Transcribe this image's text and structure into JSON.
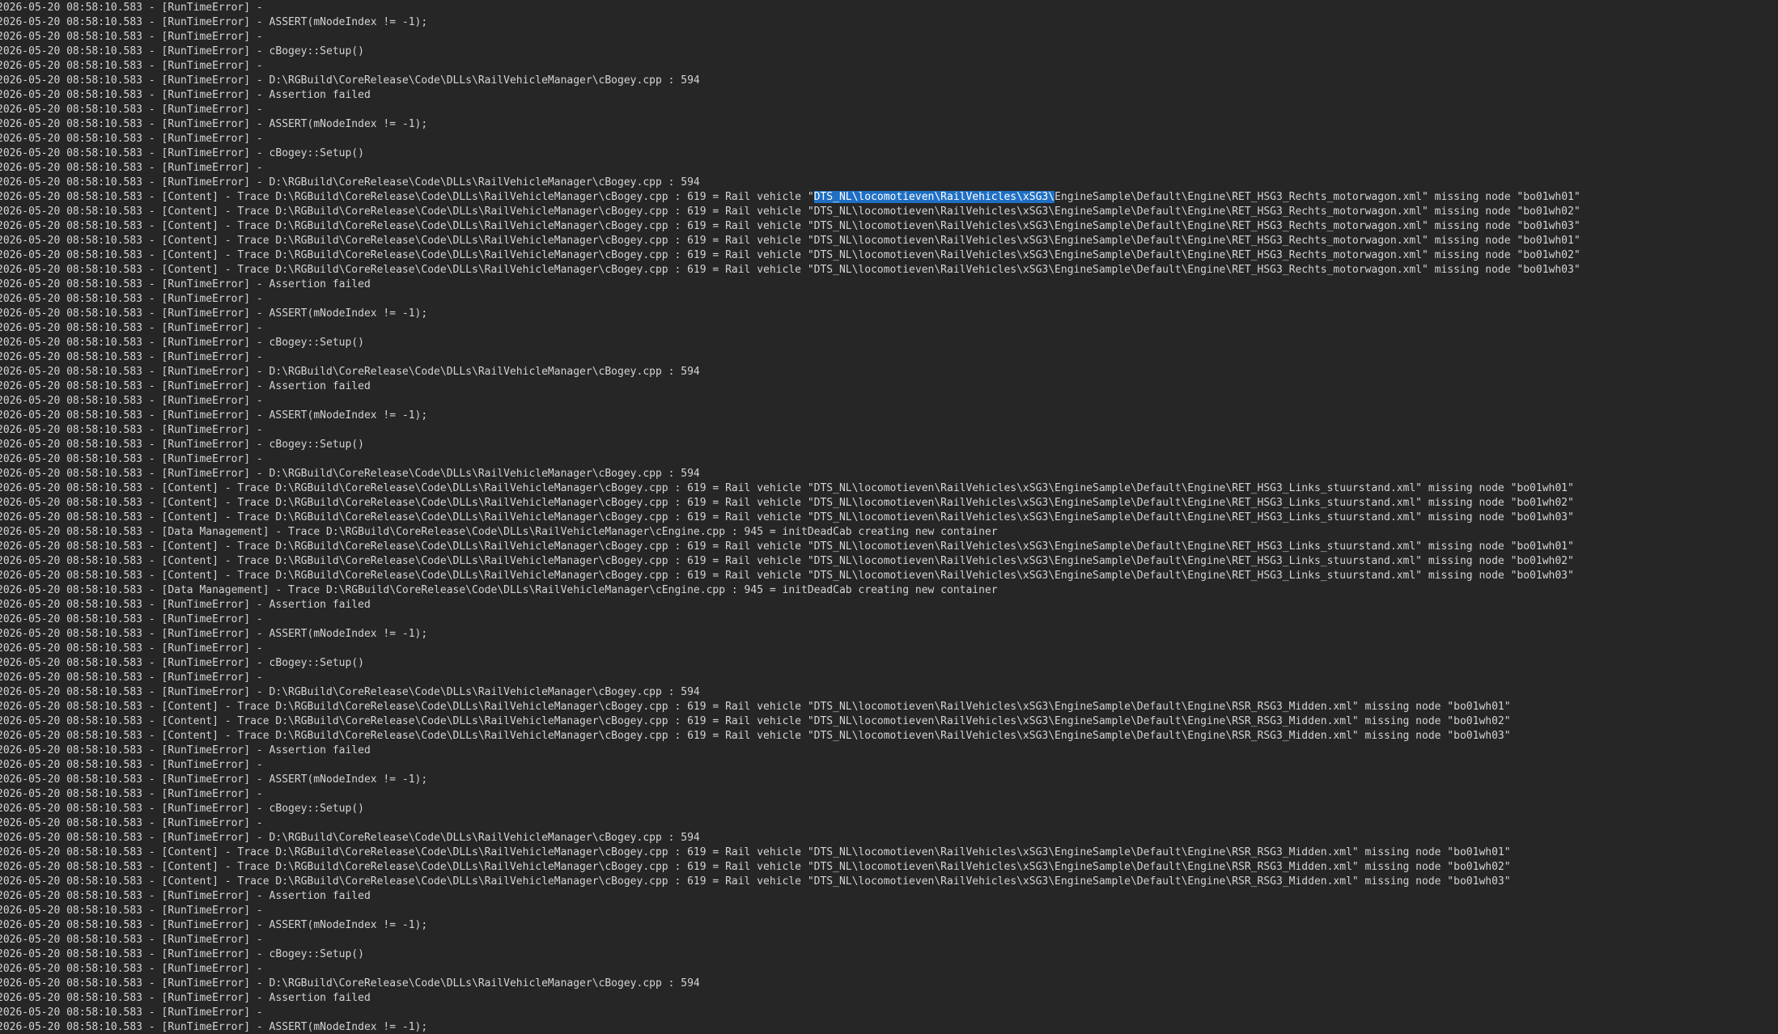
{
  "theme": {
    "background": "#262626",
    "text": "#d4d4d4",
    "selection_background": "#1f6fc5",
    "selection_text": "#ffffff"
  },
  "log": {
    "lines": [
      {
        "text": "2026-05-20 08:58:10.583 - [RunTimeError] -"
      },
      {
        "text": "2026-05-20 08:58:10.583 - [RunTimeError] - ASSERT(mNodeIndex != -1);"
      },
      {
        "text": "2026-05-20 08:58:10.583 - [RunTimeError] -"
      },
      {
        "text": "2026-05-20 08:58:10.583 - [RunTimeError] - cBogey::Setup()"
      },
      {
        "text": "2026-05-20 08:58:10.583 - [RunTimeError] -"
      },
      {
        "text": "2026-05-20 08:58:10.583 - [RunTimeError] - D:\\RGBuild\\CoreRelease\\Code\\DLLs\\RailVehicleManager\\cBogey.cpp : 594"
      },
      {
        "text": "2026-05-20 08:58:10.583 - [RunTimeError] - Assertion failed"
      },
      {
        "text": "2026-05-20 08:58:10.583 - [RunTimeError] -"
      },
      {
        "text": "2026-05-20 08:58:10.583 - [RunTimeError] - ASSERT(mNodeIndex != -1);"
      },
      {
        "text": "2026-05-20 08:58:10.583 - [RunTimeError] -"
      },
      {
        "text": "2026-05-20 08:58:10.583 - [RunTimeError] - cBogey::Setup()"
      },
      {
        "text": "2026-05-20 08:58:10.583 - [RunTimeError] -"
      },
      {
        "text": "2026-05-20 08:58:10.583 - [RunTimeError] - D:\\RGBuild\\CoreRelease\\Code\\DLLs\\RailVehicleManager\\cBogey.cpp : 594"
      },
      {
        "before": "2026-05-20 08:58:10.583 - [Content] - Trace D:\\RGBuild\\CoreRelease\\Code\\DLLs\\RailVehicleManager\\cBogey.cpp : 619 = Rail vehicle \"",
        "selected": "DTS_NL\\locomotieven\\RailVehicles\\xSG3\\",
        "after": "EngineSample\\Default\\Engine\\RET_HSG3_Rechts_motorwagon.xml\" missing node \"bo01wh01\""
      },
      {
        "text": "2026-05-20 08:58:10.583 - [Content] - Trace D:\\RGBuild\\CoreRelease\\Code\\DLLs\\RailVehicleManager\\cBogey.cpp : 619 = Rail vehicle \"DTS_NL\\locomotieven\\RailVehicles\\xSG3\\EngineSample\\Default\\Engine\\RET_HSG3_Rechts_motorwagon.xml\" missing node \"bo01wh02\""
      },
      {
        "text": "2026-05-20 08:58:10.583 - [Content] - Trace D:\\RGBuild\\CoreRelease\\Code\\DLLs\\RailVehicleManager\\cBogey.cpp : 619 = Rail vehicle \"DTS_NL\\locomotieven\\RailVehicles\\xSG3\\EngineSample\\Default\\Engine\\RET_HSG3_Rechts_motorwagon.xml\" missing node \"bo01wh03\""
      },
      {
        "text": "2026-05-20 08:58:10.583 - [Content] - Trace D:\\RGBuild\\CoreRelease\\Code\\DLLs\\RailVehicleManager\\cBogey.cpp : 619 = Rail vehicle \"DTS_NL\\locomotieven\\RailVehicles\\xSG3\\EngineSample\\Default\\Engine\\RET_HSG3_Rechts_motorwagon.xml\" missing node \"bo01wh01\""
      },
      {
        "text": "2026-05-20 08:58:10.583 - [Content] - Trace D:\\RGBuild\\CoreRelease\\Code\\DLLs\\RailVehicleManager\\cBogey.cpp : 619 = Rail vehicle \"DTS_NL\\locomotieven\\RailVehicles\\xSG3\\EngineSample\\Default\\Engine\\RET_HSG3_Rechts_motorwagon.xml\" missing node \"bo01wh02\""
      },
      {
        "text": "2026-05-20 08:58:10.583 - [Content] - Trace D:\\RGBuild\\CoreRelease\\Code\\DLLs\\RailVehicleManager\\cBogey.cpp : 619 = Rail vehicle \"DTS_NL\\locomotieven\\RailVehicles\\xSG3\\EngineSample\\Default\\Engine\\RET_HSG3_Rechts_motorwagon.xml\" missing node \"bo01wh03\""
      },
      {
        "text": "2026-05-20 08:58:10.583 - [RunTimeError] - Assertion failed"
      },
      {
        "text": "2026-05-20 08:58:10.583 - [RunTimeError] -"
      },
      {
        "text": "2026-05-20 08:58:10.583 - [RunTimeError] - ASSERT(mNodeIndex != -1);"
      },
      {
        "text": "2026-05-20 08:58:10.583 - [RunTimeError] -"
      },
      {
        "text": "2026-05-20 08:58:10.583 - [RunTimeError] - cBogey::Setup()"
      },
      {
        "text": "2026-05-20 08:58:10.583 - [RunTimeError] -"
      },
      {
        "text": "2026-05-20 08:58:10.583 - [RunTimeError] - D:\\RGBuild\\CoreRelease\\Code\\DLLs\\RailVehicleManager\\cBogey.cpp : 594"
      },
      {
        "text": "2026-05-20 08:58:10.583 - [RunTimeError] - Assertion failed"
      },
      {
        "text": "2026-05-20 08:58:10.583 - [RunTimeError] -"
      },
      {
        "text": "2026-05-20 08:58:10.583 - [RunTimeError] - ASSERT(mNodeIndex != -1);"
      },
      {
        "text": "2026-05-20 08:58:10.583 - [RunTimeError] -"
      },
      {
        "text": "2026-05-20 08:58:10.583 - [RunTimeError] - cBogey::Setup()"
      },
      {
        "text": "2026-05-20 08:58:10.583 - [RunTimeError] -"
      },
      {
        "text": "2026-05-20 08:58:10.583 - [RunTimeError] - D:\\RGBuild\\CoreRelease\\Code\\DLLs\\RailVehicleManager\\cBogey.cpp : 594"
      },
      {
        "text": "2026-05-20 08:58:10.583 - [Content] - Trace D:\\RGBuild\\CoreRelease\\Code\\DLLs\\RailVehicleManager\\cBogey.cpp : 619 = Rail vehicle \"DTS_NL\\locomotieven\\RailVehicles\\xSG3\\EngineSample\\Default\\Engine\\RET_HSG3_Links_stuurstand.xml\" missing node \"bo01wh01\""
      },
      {
        "text": "2026-05-20 08:58:10.583 - [Content] - Trace D:\\RGBuild\\CoreRelease\\Code\\DLLs\\RailVehicleManager\\cBogey.cpp : 619 = Rail vehicle \"DTS_NL\\locomotieven\\RailVehicles\\xSG3\\EngineSample\\Default\\Engine\\RET_HSG3_Links_stuurstand.xml\" missing node \"bo01wh02\""
      },
      {
        "text": "2026-05-20 08:58:10.583 - [Content] - Trace D:\\RGBuild\\CoreRelease\\Code\\DLLs\\RailVehicleManager\\cBogey.cpp : 619 = Rail vehicle \"DTS_NL\\locomotieven\\RailVehicles\\xSG3\\EngineSample\\Default\\Engine\\RET_HSG3_Links_stuurstand.xml\" missing node \"bo01wh03\""
      },
      {
        "text": "2026-05-20 08:58:10.583 - [Data Management] - Trace D:\\RGBuild\\CoreRelease\\Code\\DLLs\\RailVehicleManager\\cEngine.cpp : 945 = initDeadCab creating new container"
      },
      {
        "text": "2026-05-20 08:58:10.583 - [Content] - Trace D:\\RGBuild\\CoreRelease\\Code\\DLLs\\RailVehicleManager\\cBogey.cpp : 619 = Rail vehicle \"DTS_NL\\locomotieven\\RailVehicles\\xSG3\\EngineSample\\Default\\Engine\\RET_HSG3_Links_stuurstand.xml\" missing node \"bo01wh01\""
      },
      {
        "text": "2026-05-20 08:58:10.583 - [Content] - Trace D:\\RGBuild\\CoreRelease\\Code\\DLLs\\RailVehicleManager\\cBogey.cpp : 619 = Rail vehicle \"DTS_NL\\locomotieven\\RailVehicles\\xSG3\\EngineSample\\Default\\Engine\\RET_HSG3_Links_stuurstand.xml\" missing node \"bo01wh02\""
      },
      {
        "text": "2026-05-20 08:58:10.583 - [Content] - Trace D:\\RGBuild\\CoreRelease\\Code\\DLLs\\RailVehicleManager\\cBogey.cpp : 619 = Rail vehicle \"DTS_NL\\locomotieven\\RailVehicles\\xSG3\\EngineSample\\Default\\Engine\\RET_HSG3_Links_stuurstand.xml\" missing node \"bo01wh03\""
      },
      {
        "text": "2026-05-20 08:58:10.583 - [Data Management] - Trace D:\\RGBuild\\CoreRelease\\Code\\DLLs\\RailVehicleManager\\cEngine.cpp : 945 = initDeadCab creating new container"
      },
      {
        "text": "2026-05-20 08:58:10.583 - [RunTimeError] - Assertion failed"
      },
      {
        "text": "2026-05-20 08:58:10.583 - [RunTimeError] -"
      },
      {
        "text": "2026-05-20 08:58:10.583 - [RunTimeError] - ASSERT(mNodeIndex != -1);"
      },
      {
        "text": "2026-05-20 08:58:10.583 - [RunTimeError] -"
      },
      {
        "text": "2026-05-20 08:58:10.583 - [RunTimeError] - cBogey::Setup()"
      },
      {
        "text": "2026-05-20 08:58:10.583 - [RunTimeError] -"
      },
      {
        "text": "2026-05-20 08:58:10.583 - [RunTimeError] - D:\\RGBuild\\CoreRelease\\Code\\DLLs\\RailVehicleManager\\cBogey.cpp : 594"
      },
      {
        "text": "2026-05-20 08:58:10.583 - [Content] - Trace D:\\RGBuild\\CoreRelease\\Code\\DLLs\\RailVehicleManager\\cBogey.cpp : 619 = Rail vehicle \"DTS_NL\\locomotieven\\RailVehicles\\xSG3\\EngineSample\\Default\\Engine\\RSR_RSG3_Midden.xml\" missing node \"bo01wh01\""
      },
      {
        "text": "2026-05-20 08:58:10.583 - [Content] - Trace D:\\RGBuild\\CoreRelease\\Code\\DLLs\\RailVehicleManager\\cBogey.cpp : 619 = Rail vehicle \"DTS_NL\\locomotieven\\RailVehicles\\xSG3\\EngineSample\\Default\\Engine\\RSR_RSG3_Midden.xml\" missing node \"bo01wh02\""
      },
      {
        "text": "2026-05-20 08:58:10.583 - [Content] - Trace D:\\RGBuild\\CoreRelease\\Code\\DLLs\\RailVehicleManager\\cBogey.cpp : 619 = Rail vehicle \"DTS_NL\\locomotieven\\RailVehicles\\xSG3\\EngineSample\\Default\\Engine\\RSR_RSG3_Midden.xml\" missing node \"bo01wh03\""
      },
      {
        "text": "2026-05-20 08:58:10.583 - [RunTimeError] - Assertion failed"
      },
      {
        "text": "2026-05-20 08:58:10.583 - [RunTimeError] -"
      },
      {
        "text": "2026-05-20 08:58:10.583 - [RunTimeError] - ASSERT(mNodeIndex != -1);"
      },
      {
        "text": "2026-05-20 08:58:10.583 - [RunTimeError] -"
      },
      {
        "text": "2026-05-20 08:58:10.583 - [RunTimeError] - cBogey::Setup()"
      },
      {
        "text": "2026-05-20 08:58:10.583 - [RunTimeError] -"
      },
      {
        "text": "2026-05-20 08:58:10.583 - [RunTimeError] - D:\\RGBuild\\CoreRelease\\Code\\DLLs\\RailVehicleManager\\cBogey.cpp : 594"
      },
      {
        "text": "2026-05-20 08:58:10.583 - [Content] - Trace D:\\RGBuild\\CoreRelease\\Code\\DLLs\\RailVehicleManager\\cBogey.cpp : 619 = Rail vehicle \"DTS_NL\\locomotieven\\RailVehicles\\xSG3\\EngineSample\\Default\\Engine\\RSR_RSG3_Midden.xml\" missing node \"bo01wh01\""
      },
      {
        "text": "2026-05-20 08:58:10.583 - [Content] - Trace D:\\RGBuild\\CoreRelease\\Code\\DLLs\\RailVehicleManager\\cBogey.cpp : 619 = Rail vehicle \"DTS_NL\\locomotieven\\RailVehicles\\xSG3\\EngineSample\\Default\\Engine\\RSR_RSG3_Midden.xml\" missing node \"bo01wh02\""
      },
      {
        "text": "2026-05-20 08:58:10.583 - [Content] - Trace D:\\RGBuild\\CoreRelease\\Code\\DLLs\\RailVehicleManager\\cBogey.cpp : 619 = Rail vehicle \"DTS_NL\\locomotieven\\RailVehicles\\xSG3\\EngineSample\\Default\\Engine\\RSR_RSG3_Midden.xml\" missing node \"bo01wh03\""
      },
      {
        "text": "2026-05-20 08:58:10.583 - [RunTimeError] - Assertion failed"
      },
      {
        "text": "2026-05-20 08:58:10.583 - [RunTimeError] -"
      },
      {
        "text": "2026-05-20 08:58:10.583 - [RunTimeError] - ASSERT(mNodeIndex != -1);"
      },
      {
        "text": "2026-05-20 08:58:10.583 - [RunTimeError] -"
      },
      {
        "text": "2026-05-20 08:58:10.583 - [RunTimeError] - cBogey::Setup()"
      },
      {
        "text": "2026-05-20 08:58:10.583 - [RunTimeError] -"
      },
      {
        "text": "2026-05-20 08:58:10.583 - [RunTimeError] - D:\\RGBuild\\CoreRelease\\Code\\DLLs\\RailVehicleManager\\cBogey.cpp : 594"
      },
      {
        "text": "2026-05-20 08:58:10.583 - [RunTimeError] - Assertion failed"
      },
      {
        "text": "2026-05-20 08:58:10.583 - [RunTimeError] -"
      },
      {
        "text": "2026-05-20 08:58:10.583 - [RunTimeError] - ASSERT(mNodeIndex != -1);"
      }
    ]
  }
}
